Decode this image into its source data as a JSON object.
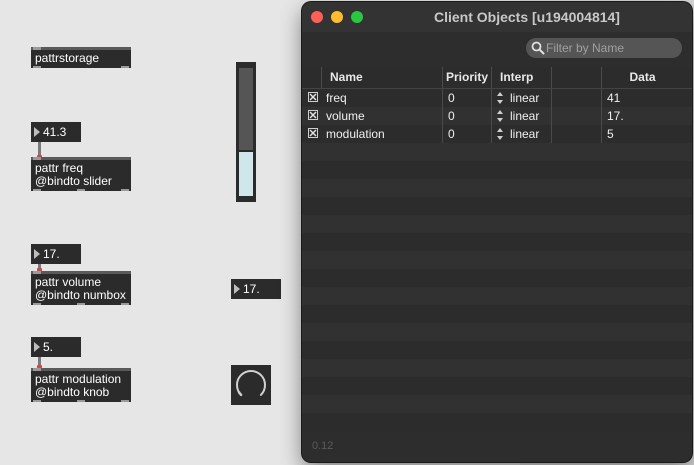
{
  "patcher": {
    "pattrstorage": {
      "text": "pattrstorage"
    },
    "freq_numbox": {
      "value": "41.3"
    },
    "freq_pattr": {
      "line1": "pattr freq",
      "line2": "@bindto slider"
    },
    "volume_numbox": {
      "value": "17."
    },
    "volume_pattr": {
      "line1": "pattr volume",
      "line2": "@bindto numbox"
    },
    "volume_target_numbox": {
      "value": "17."
    },
    "mod_numbox": {
      "value": "5."
    },
    "mod_pattr": {
      "line1": "pattr modulation",
      "line2": "@bindto knob"
    },
    "slider_level": 0.34,
    "knob_level": 0.05
  },
  "window": {
    "title": "Client Objects [u194004814]",
    "search": {
      "placeholder": "Filter by Name",
      "icon": "magnifier-icon"
    },
    "columns": {
      "name": "Name",
      "priority": "Priority",
      "interp": "Interp",
      "data": "Data"
    },
    "rows": [
      {
        "checked": true,
        "name": "freq",
        "priority": "0",
        "interp": "linear",
        "data": "41"
      },
      {
        "checked": true,
        "name": "volume",
        "priority": "0",
        "interp": "linear",
        "data": "17."
      },
      {
        "checked": true,
        "name": "modulation",
        "priority": "0",
        "interp": "linear",
        "data": "5"
      }
    ],
    "footer": {
      "version": "0.12"
    }
  }
}
